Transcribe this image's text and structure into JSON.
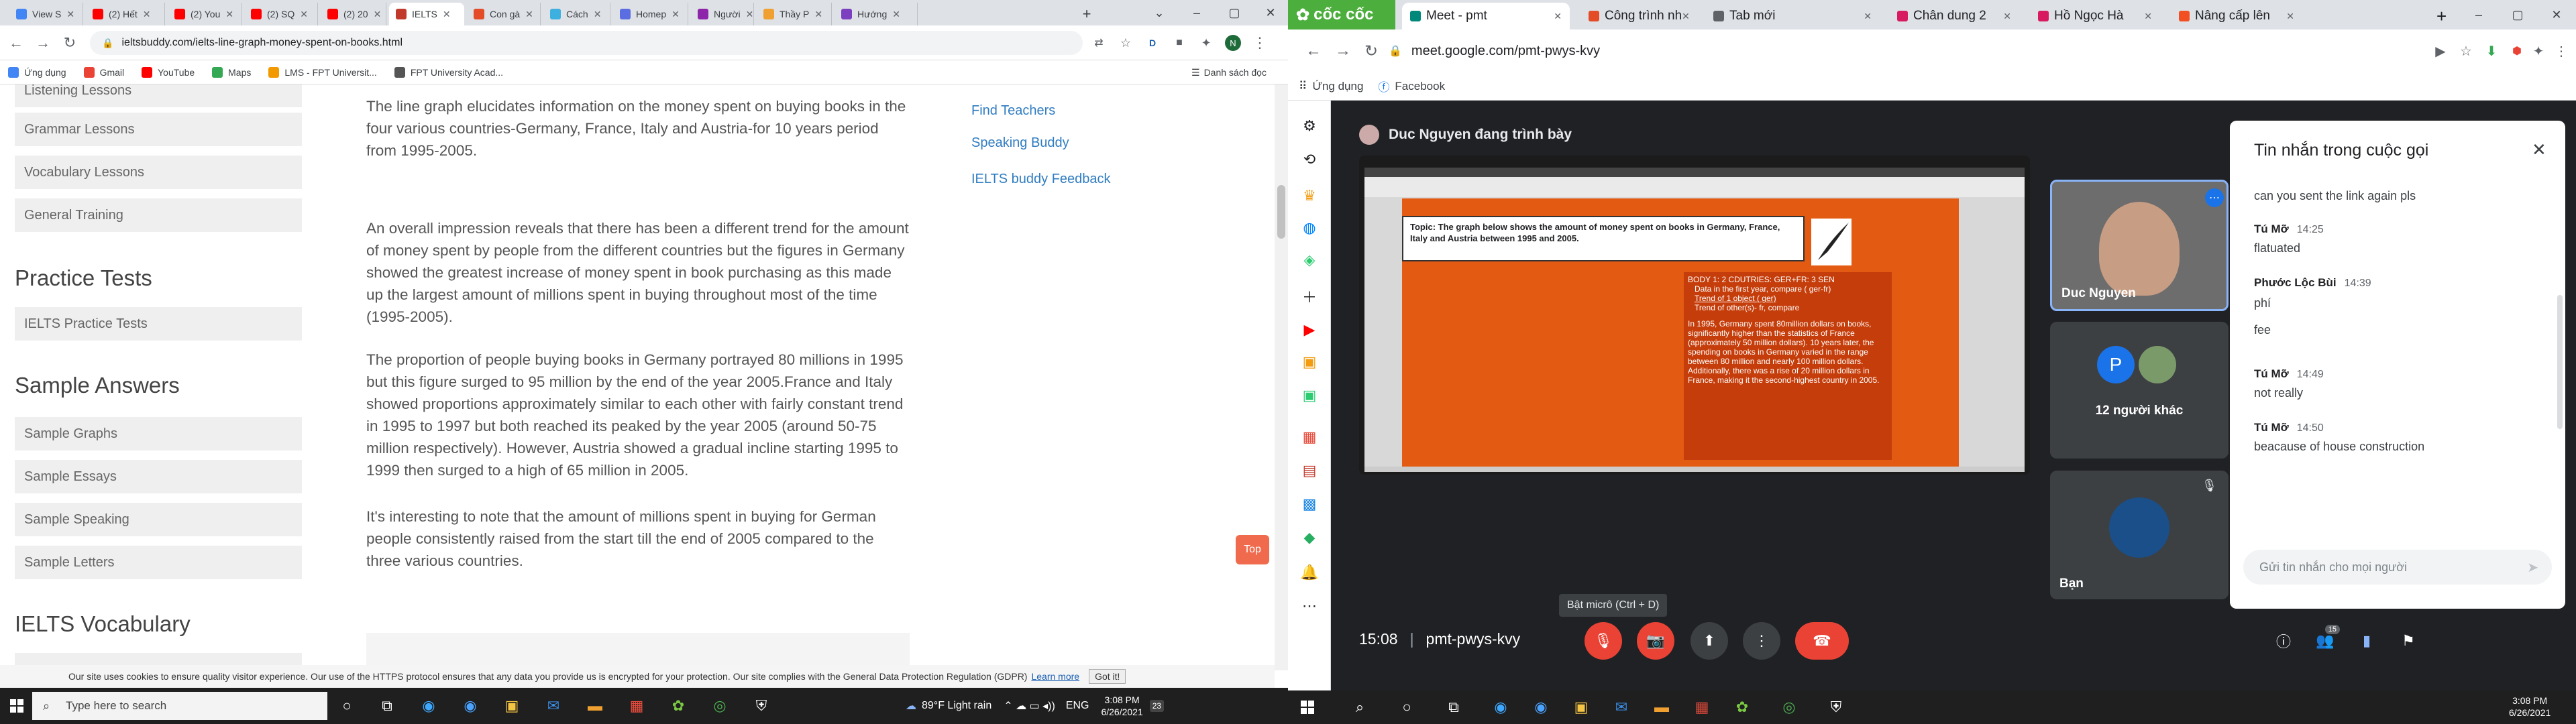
{
  "left": {
    "tabs": [
      {
        "label": "View S",
        "color": "#4285f4"
      },
      {
        "label": "(2) Hết",
        "color": "#ff0000"
      },
      {
        "label": "(2) You",
        "color": "#ff0000"
      },
      {
        "label": "(2) SQ",
        "color": "#ff0000"
      },
      {
        "label": "(2) 20",
        "color": "#ff0000"
      },
      {
        "label": "IELTS",
        "color": "#c0392b"
      },
      {
        "label": "Con gà",
        "color": "#e34c26"
      },
      {
        "label": "Cách",
        "color": "#3db0e0"
      },
      {
        "label": "Homep",
        "color": "#5b6ee1"
      },
      {
        "label": "Người",
        "color": "#8e24aa"
      },
      {
        "label": "Thầy P",
        "color": "#f0a030"
      },
      {
        "label": "Hướng",
        "color": "#7b3fbf"
      }
    ],
    "url": "ieltsbuddy.com/ielts-line-graph-money-spent-on-books.html",
    "bookmarks": [
      {
        "label": "Ứng dụng",
        "color": "#4285f4"
      },
      {
        "label": "Gmail",
        "color": "#ea4335"
      },
      {
        "label": "YouTube",
        "color": "#ff0000"
      },
      {
        "label": "Maps",
        "color": "#34a853"
      },
      {
        "label": "LMS - FPT Universit...",
        "color": "#f29900"
      },
      {
        "label": "FPT University Acad...",
        "color": "#555555"
      }
    ],
    "reading_list": "Danh sách đọc",
    "sidebar": {
      "top_items": [
        "Listening Lessons",
        "Grammar Lessons",
        "Vocabulary Lessons",
        "General Training"
      ],
      "practice_heading": "Practice Tests",
      "practice_items": [
        "IELTS Practice Tests"
      ],
      "samples_heading": "Sample Answers",
      "sample_items": [
        "Sample Graphs",
        "Sample Essays",
        "Sample Speaking",
        "Sample Letters"
      ],
      "vocab_heading": "IELTS Vocabulary"
    },
    "article": {
      "p1": "The line graph elucidates information on the money spent on buying books in the four various countries-Germany, France, Italy and Austria-for 10 years period from 1995-2005.",
      "p2": "An overall impression reveals that there has been a different trend for the amount of money spent by people from the different countries but the figures in Germany showed the greatest increase of money spent in book purchasing as this made up the largest amount of millions spent in buying throughout most of the time (1995-2005).",
      "p3": "The proportion of people buying books in Germany portrayed 80 millions in 1995 but this figure surged to 95 million by the end of the year 2005.France and Italy showed proportions approximately similar to each other with fairly constant trend in 1995 to 1997 but both reached its peaked by the year 2005 (around 50-75 million respectively). However, Austria showed a gradual incline starting 1995 to 1999 then surged to a high of 65 million in 2005.",
      "p4": "It's interesting to note that the amount of millions spent in buying for German people consistently raised from the start till the end of 2005 compared to the three various countries."
    },
    "right_links": [
      "Find Teachers",
      "Speaking Buddy",
      "IELTS buddy Feedback"
    ],
    "top_button": "Top",
    "cookie": {
      "text": "Our site uses cookies to ensure quality visitor experience. Our use of the HTTPS protocol ensures that any data you provide us is encrypted for your protection. Our site complies with the General Data Protection Regulation (GDPR)",
      "link": "Learn more",
      "button": "Got it!"
    },
    "taskbar": {
      "search": "Type here to search",
      "weather": "89°F  Light rain",
      "lang": "ENG",
      "time": "3:08 PM",
      "date": "6/26/2021",
      "notif": "23"
    }
  },
  "right": {
    "brand": "cốc cốc",
    "tabs": [
      "Meet - pmt",
      "Công trình nh",
      "Tab mới",
      "Chân dung 2",
      "Hồ Ngọc Hà",
      "Nâng cấp lên"
    ],
    "url": "meet.google.com/pmt-pwys-kvy",
    "bookmarks": [
      "Ứng dụng",
      "Facebook"
    ],
    "presenter": "Duc Nguyen đang trình bày",
    "slide": {
      "topic": "Topic: The graph below shows the amount of money spent on books in Germany, France, Italy and Austria between 1995 and 2005.",
      "body_head": "BODY 1: 2 CDUTRIES: GER+FR: 3 SEN",
      "b1": "Data in the first year, compare ( ger-fr)",
      "b2": "Trend of 1 object ( ger)",
      "b3": "Trend of other(s)- fr, compare",
      "para": "In 1995, Germany spent 80million dollars on books, significantly higher than the statistics of France (approximately 50 million dollars). 10 years later, the spending on books in Germany varied in the range between 80 million and nearly 100 million dollars. Additionally, there was a rise of 20 million dollars in France, making it the second-highest country in 2005."
    },
    "tiles": {
      "duc": "Duc Nguyen",
      "others": "12 người khác",
      "others_initial": "P",
      "you": "Bạn"
    },
    "chat": {
      "title": "Tin nhắn trong cuộc gọi",
      "first": "can you sent the link again pls",
      "messages": [
        {
          "name": "Tú Mỡ",
          "time": "14:25",
          "text": "flatuated"
        },
        {
          "name": "Phước Lộc Bùi",
          "time": "14:39",
          "text": "phí"
        },
        {
          "name": "",
          "time": "",
          "text": "fee"
        },
        {
          "name": "Tú Mỡ",
          "time": "14:49",
          "text": "not really"
        },
        {
          "name": "Tú Mỡ",
          "time": "14:50",
          "text": "beacause of house construction"
        }
      ],
      "placeholder": "Gửi tin nhắn cho mọi người"
    },
    "tooltip": "Bật micrô (Ctrl + D)",
    "time": "15:08",
    "meeting_code": "pmt-pwys-kvy",
    "people_count": "15",
    "taskbar": {
      "time": "3:08 PM",
      "date": "6/26/2021"
    }
  }
}
